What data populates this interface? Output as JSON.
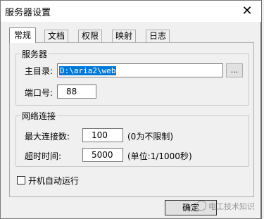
{
  "window": {
    "title": "服务器设置",
    "close_glyph": "✕"
  },
  "tabs": [
    {
      "label": "常规",
      "active": true
    },
    {
      "label": "文档"
    },
    {
      "label": "权限"
    },
    {
      "label": "映射"
    },
    {
      "label": "日志"
    }
  ],
  "server_group": {
    "title": "服务器",
    "home_dir_label": "主目录:",
    "home_dir_value": "D:\\aria2\\web",
    "browse_label": "...",
    "port_label": "端口号:",
    "port_value": "88"
  },
  "network_group": {
    "title": "网络连接",
    "max_conn_label": "最大连接数:",
    "max_conn_value": "100",
    "max_conn_hint": "(0为不限制)",
    "timeout_label": "超时时间:",
    "timeout_value": "5000",
    "timeout_hint": "(单位:1/1000秒)"
  },
  "autostart": {
    "label": "开机自动运行",
    "checked": false
  },
  "ok_button": {
    "label": "确定"
  },
  "watermark": {
    "text": "电工技术知识",
    "icon": "wechat-icon"
  },
  "colors": {
    "selection": "#0078d7",
    "background": "#f0f0f0"
  }
}
